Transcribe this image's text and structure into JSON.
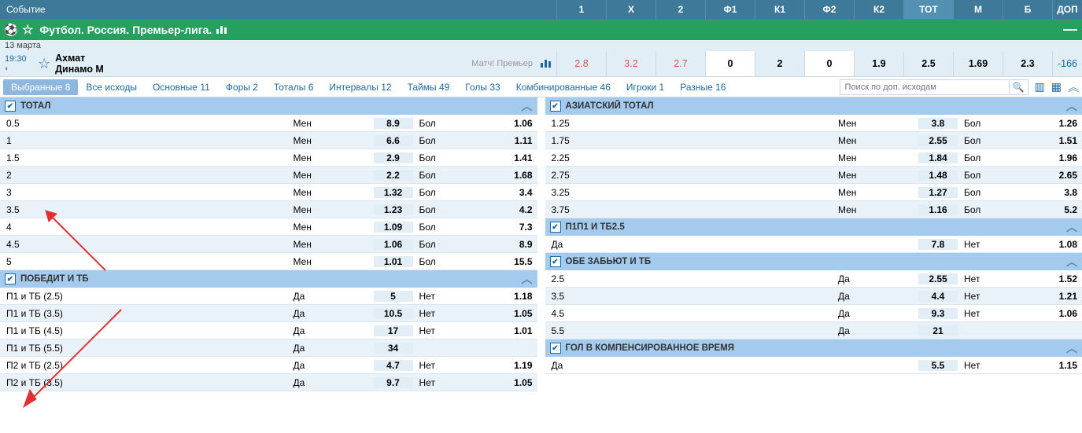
{
  "header": {
    "event_label": "Событие",
    "columns": [
      "1",
      "Х",
      "2",
      "Ф1",
      "К1",
      "Ф2",
      "К2",
      "ТОТ",
      "М",
      "Б",
      "ДОП"
    ]
  },
  "league": {
    "title": "Футбол. Россия. Премьер-лига."
  },
  "match": {
    "date": "13 марта",
    "time": "19:30",
    "home": "Ахмат",
    "away": "Динамо М",
    "tv": "Матч! Премьер",
    "odds": [
      "2.8",
      "3.2",
      "2.7",
      "0",
      "2",
      "0",
      "1.9",
      "2.5",
      "1.69",
      "2.3",
      "-166"
    ]
  },
  "tabs": [
    {
      "label": "Выбранные 8",
      "active": true
    },
    {
      "label": "Все исходы"
    },
    {
      "label": "Основные 11"
    },
    {
      "label": "Форы 2"
    },
    {
      "label": "Тоталы 6"
    },
    {
      "label": "Интервалы 12"
    },
    {
      "label": "Таймы 49"
    },
    {
      "label": "Голы 33"
    },
    {
      "label": "Комбинированные 46"
    },
    {
      "label": "Игроки 1"
    },
    {
      "label": "Разные 16"
    }
  ],
  "search_placeholder": "Поиск по доп. исходам",
  "panels": {
    "total": {
      "title": "ТОТАЛ",
      "rows": [
        {
          "v": "0.5",
          "l1": "Мен",
          "o1": "8.9",
          "l2": "Бол",
          "o2": "1.06"
        },
        {
          "v": "1",
          "l1": "Мен",
          "o1": "6.6",
          "l2": "Бол",
          "o2": "1.11"
        },
        {
          "v": "1.5",
          "l1": "Мен",
          "o1": "2.9",
          "l2": "Бол",
          "o2": "1.41"
        },
        {
          "v": "2",
          "l1": "Мен",
          "o1": "2.2",
          "l2": "Бол",
          "o2": "1.68"
        },
        {
          "v": "3",
          "l1": "Мен",
          "o1": "1.32",
          "l2": "Бол",
          "o2": "3.4"
        },
        {
          "v": "3.5",
          "l1": "Мен",
          "o1": "1.23",
          "l2": "Бол",
          "o2": "4.2"
        },
        {
          "v": "4",
          "l1": "Мен",
          "o1": "1.09",
          "l2": "Бол",
          "o2": "7.3"
        },
        {
          "v": "4.5",
          "l1": "Мен",
          "o1": "1.06",
          "l2": "Бол",
          "o2": "8.9"
        },
        {
          "v": "5",
          "l1": "Мен",
          "o1": "1.01",
          "l2": "Бол",
          "o2": "15.5"
        }
      ]
    },
    "win_tb": {
      "title": "ПОБЕДИТ И ТБ",
      "rows": [
        {
          "v": "П1 и ТБ (2.5)",
          "l1": "Да",
          "o1": "5",
          "l2": "Нет",
          "o2": "1.18"
        },
        {
          "v": "П1 и ТБ (3.5)",
          "l1": "Да",
          "o1": "10.5",
          "l2": "Нет",
          "o2": "1.05"
        },
        {
          "v": "П1 и ТБ (4.5)",
          "l1": "Да",
          "o1": "17",
          "l2": "Нет",
          "o2": "1.01"
        },
        {
          "v": "П1 и ТБ (5.5)",
          "l1": "Да",
          "o1": "34",
          "l2": "",
          "o2": ""
        },
        {
          "v": "П2 и ТБ (2.5)",
          "l1": "Да",
          "o1": "4.7",
          "l2": "Нет",
          "o2": "1.19"
        },
        {
          "v": "П2 и ТБ (3.5)",
          "l1": "Да",
          "o1": "9.7",
          "l2": "Нет",
          "o2": "1.05"
        }
      ]
    },
    "asian": {
      "title": "АЗИАТСКИЙ ТОТАЛ",
      "rows": [
        {
          "v": "1.25",
          "l1": "Мен",
          "o1": "3.8",
          "l2": "Бол",
          "o2": "1.26"
        },
        {
          "v": "1.75",
          "l1": "Мен",
          "o1": "2.55",
          "l2": "Бол",
          "o2": "1.51"
        },
        {
          "v": "2.25",
          "l1": "Мен",
          "o1": "1.84",
          "l2": "Бол",
          "o2": "1.96"
        },
        {
          "v": "2.75",
          "l1": "Мен",
          "o1": "1.48",
          "l2": "Бол",
          "o2": "2.65"
        },
        {
          "v": "3.25",
          "l1": "Мен",
          "o1": "1.27",
          "l2": "Бол",
          "o2": "3.8"
        },
        {
          "v": "3.75",
          "l1": "Мен",
          "o1": "1.16",
          "l2": "Бол",
          "o2": "5.2"
        }
      ]
    },
    "p1p1": {
      "title": "П1П1 И ТБ2.5",
      "rows": [
        {
          "v": "Да",
          "l1": "",
          "o1": "7.8",
          "l2": "Нет",
          "o2": "1.08"
        }
      ]
    },
    "both": {
      "title": "ОБЕ ЗАБЬЮТ И ТБ",
      "rows": [
        {
          "v": "2.5",
          "l1": "Да",
          "o1": "2.55",
          "l2": "Нет",
          "o2": "1.52"
        },
        {
          "v": "3.5",
          "l1": "Да",
          "o1": "4.4",
          "l2": "Нет",
          "o2": "1.21"
        },
        {
          "v": "4.5",
          "l1": "Да",
          "o1": "9.3",
          "l2": "Нет",
          "o2": "1.06"
        },
        {
          "v": "5.5",
          "l1": "Да",
          "o1": "21",
          "l2": "",
          "o2": ""
        }
      ]
    },
    "comp": {
      "title": "ГОЛ В КОМПЕНСИРОВАННОЕ ВРЕМЯ",
      "rows": [
        {
          "v": "Да",
          "l1": "",
          "o1": "5.5",
          "l2": "Нет",
          "o2": "1.15"
        }
      ]
    }
  }
}
